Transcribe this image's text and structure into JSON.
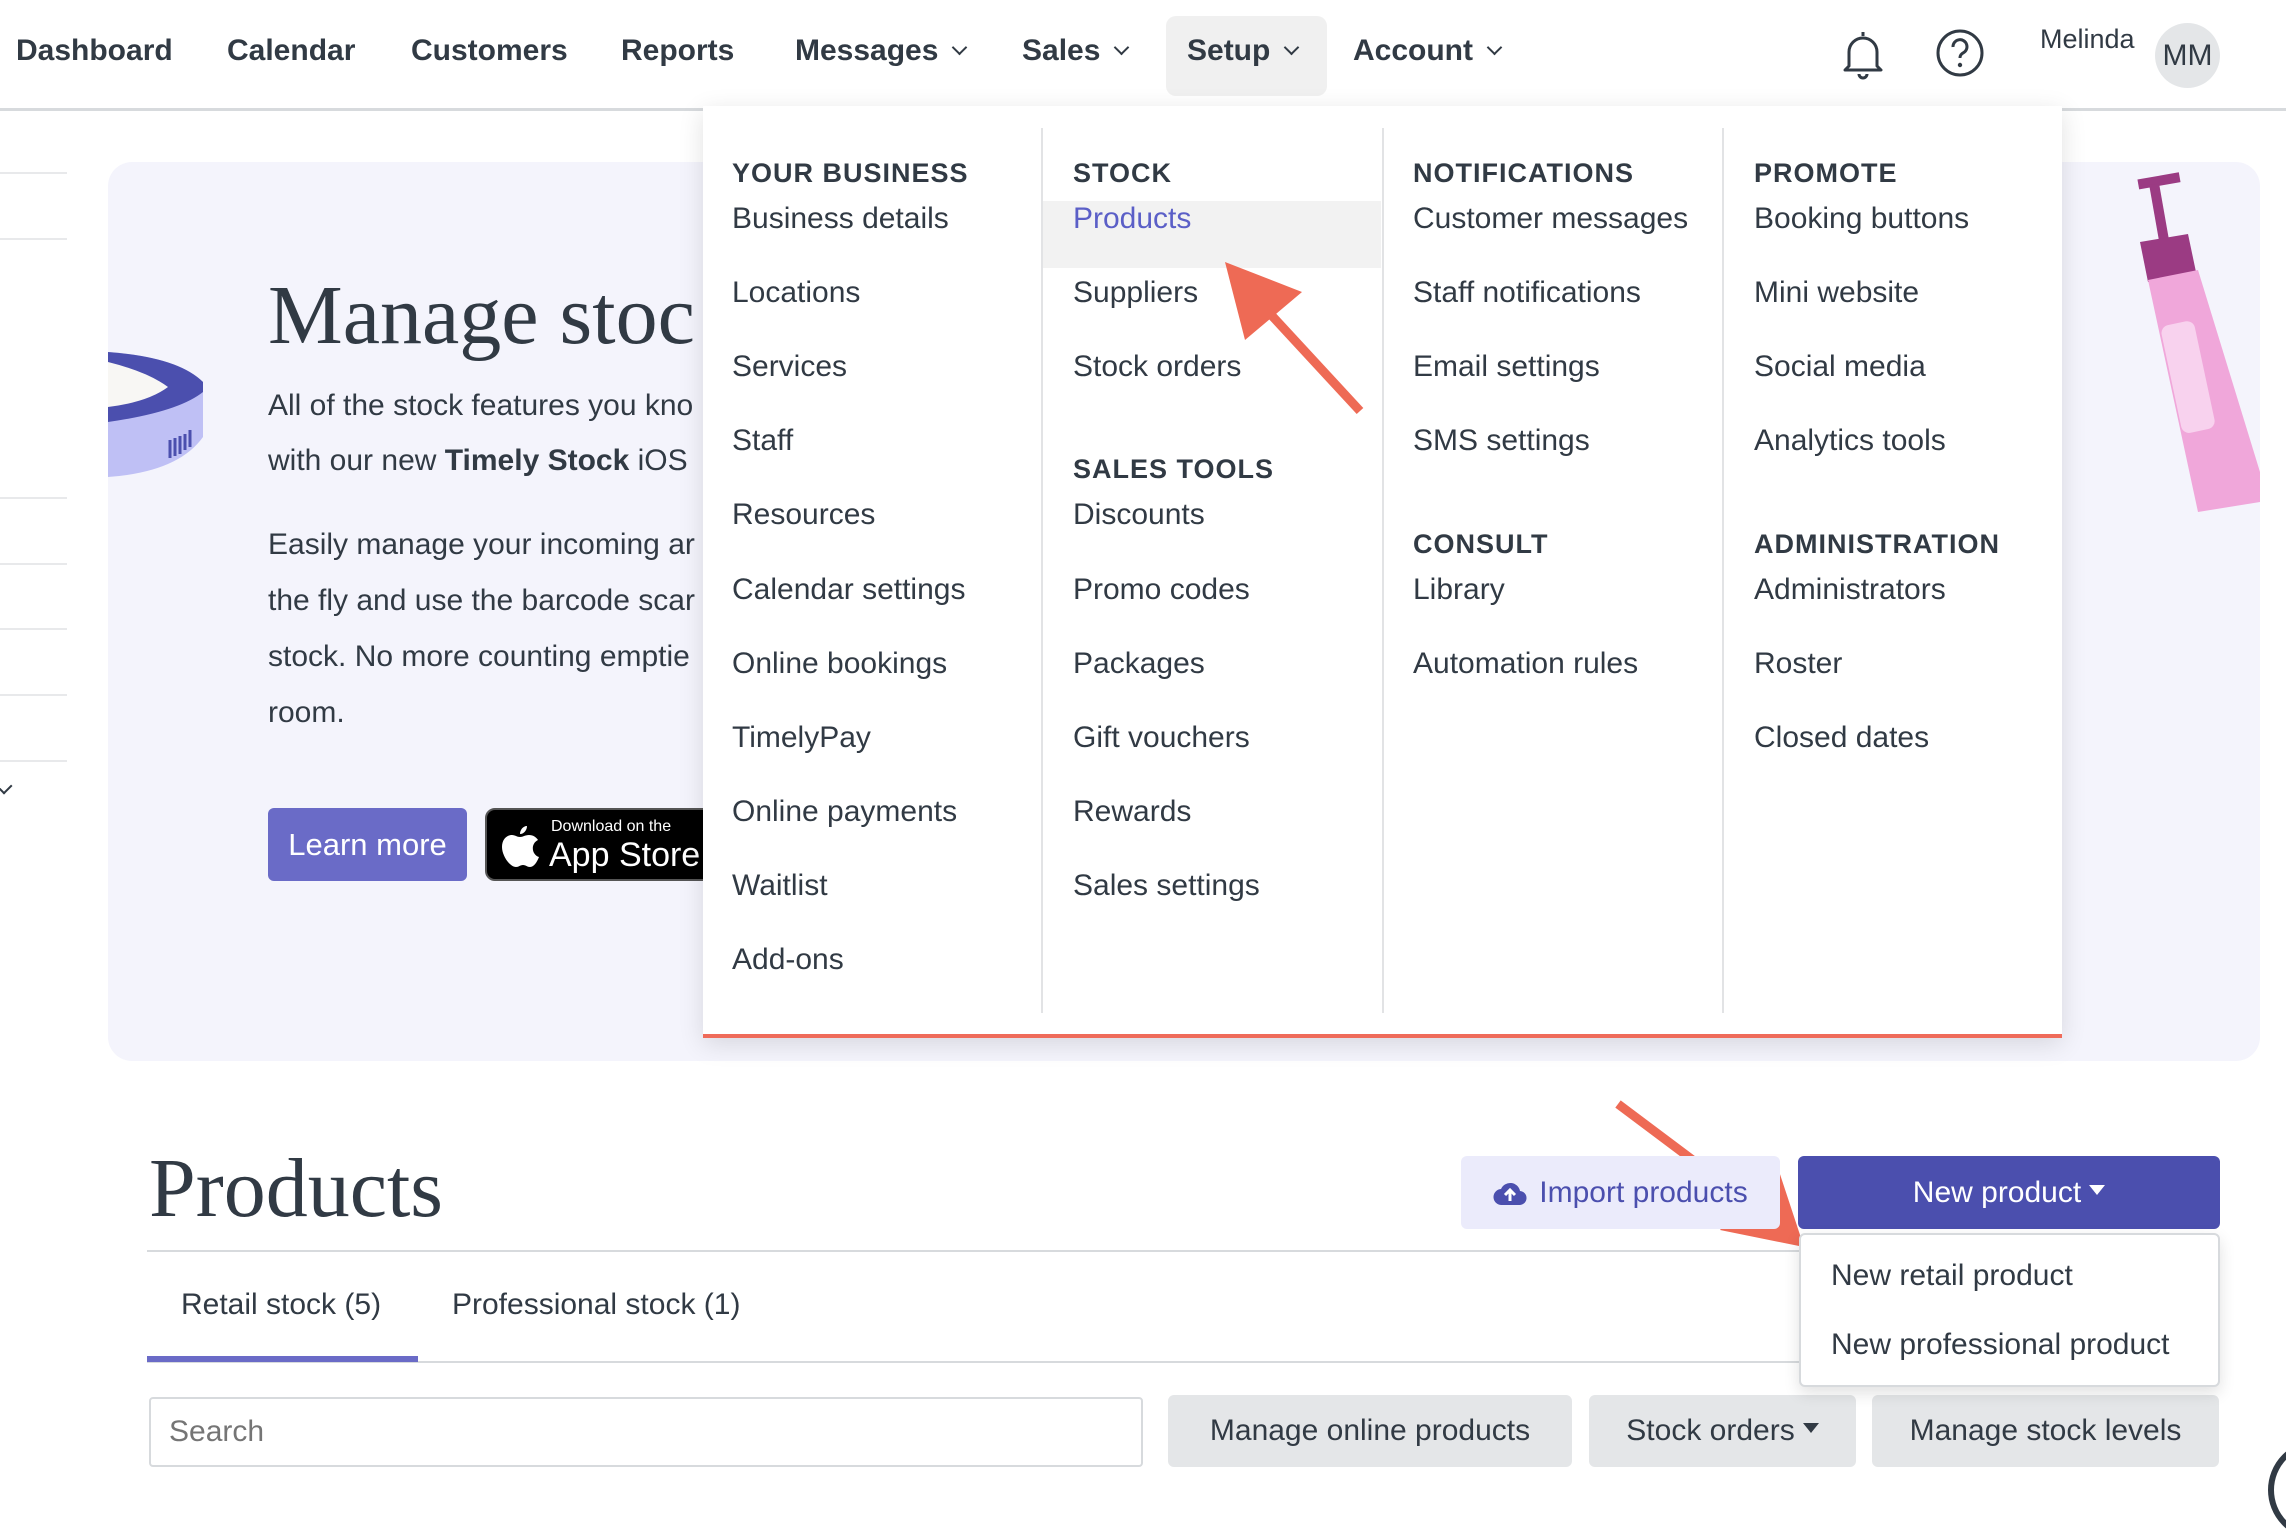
{
  "nav": {
    "items": [
      {
        "label": "Dashboard"
      },
      {
        "label": "Calendar"
      },
      {
        "label": "Customers"
      },
      {
        "label": "Reports"
      },
      {
        "label": "Messages",
        "dropdown": true
      },
      {
        "label": "Sales",
        "dropdown": true
      },
      {
        "label": "Setup",
        "dropdown": true,
        "active": true
      },
      {
        "label": "Account",
        "dropdown": true
      }
    ],
    "user_name": "Melinda",
    "avatar_initials": "MM",
    "icons": [
      "bell-icon",
      "help-icon"
    ]
  },
  "banner": {
    "title": "Manage stoc",
    "lines": [
      "All of the stock features you kno",
      "with our new ",
      "Timely Stock",
      " iOS",
      "Easily manage your incoming ar",
      "the fly and use the barcode scar",
      "stock. No more counting emptie",
      "room."
    ],
    "learn_more": "Learn more",
    "appstore_small": "Download on the",
    "appstore_big": "App Store"
  },
  "setup_menu": {
    "columns": [
      {
        "sections": [
          {
            "heading": "YOUR BUSINESS",
            "items": [
              "Business details",
              "Locations",
              "Services",
              "Staff",
              "Resources",
              "Calendar settings",
              "Online bookings",
              "TimelyPay",
              "Online payments",
              "Waitlist",
              "Add-ons"
            ]
          }
        ]
      },
      {
        "sections": [
          {
            "heading": "STOCK",
            "items": [
              "Products",
              "Suppliers",
              "Stock orders"
            ]
          },
          {
            "heading": "SALES TOOLS",
            "items": [
              "Discounts",
              "Promo codes",
              "Packages",
              "Gift vouchers",
              "Rewards",
              "Sales settings"
            ]
          }
        ]
      },
      {
        "sections": [
          {
            "heading": "NOTIFICATIONS",
            "items": [
              "Customer messages",
              "Staff notifications",
              "Email settings",
              "SMS settings"
            ]
          },
          {
            "heading": "CONSULT",
            "items": [
              "Library",
              "Automation rules"
            ]
          }
        ]
      },
      {
        "sections": [
          {
            "heading": "PROMOTE",
            "items": [
              "Booking buttons",
              "Mini website",
              "Social media",
              "Analytics tools"
            ]
          },
          {
            "heading": "ADMINISTRATION",
            "items": [
              "Administrators",
              "Roster",
              "Closed dates"
            ]
          }
        ]
      }
    ],
    "highlighted": "Products"
  },
  "products": {
    "title": "Products",
    "import_label": "Import products",
    "new_product_label": "New product",
    "new_product_menu": [
      "New retail product",
      "New professional product"
    ],
    "tabs": [
      {
        "label": "Retail stock (5)",
        "active": true
      },
      {
        "label": "Professional stock (1)"
      }
    ],
    "search_placeholder": "Search",
    "buttons": {
      "manage_online": "Manage online products",
      "stock_orders": "Stock orders",
      "manage_levels": "Manage stock levels"
    }
  },
  "colors": {
    "accent": "#4b4fae",
    "learn_more": "#6a6bc7",
    "annotation_arrow": "#ee6a55",
    "menu_border": "#ef6b5a",
    "banner_bg": "#f4f4fc"
  }
}
